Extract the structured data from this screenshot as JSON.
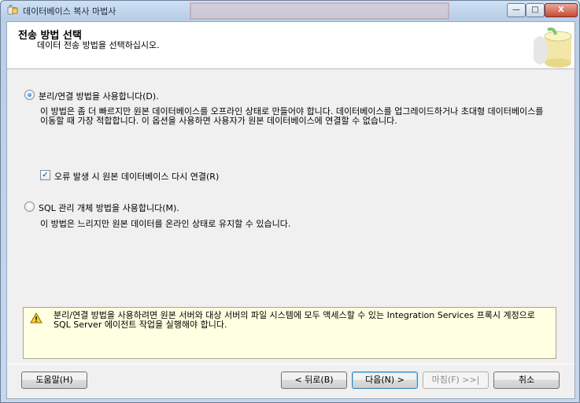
{
  "window": {
    "title": "데이터베이스 복사 마법사",
    "controls": {
      "minimize": "—",
      "maximize": "□",
      "close": "X"
    }
  },
  "header": {
    "title": "전송 방법 선택",
    "subtitle": "데이터 전송 방법을 선택하십시오."
  },
  "options": {
    "detach_attach": {
      "label": "분리/연결 방법을 사용합니다(D).",
      "selected": true,
      "description": "이 방법은 좀 더 빠르지만 원본 데이터베이스를 오프라인 상태로 만들어야 합니다. 데이터베이스를 업그레이드하거나 초대형 데이터베이스를 이동할 때 가장 적합합니다. 이 옵션을 사용하면 사용자가 원본 데이터베이스에 연결할 수 없습니다.",
      "reattach_checkbox": {
        "label": "오류 발생 시 원본 데이터베이스 다시 연결(R)",
        "checked": true
      }
    },
    "smo": {
      "label": "SQL 관리 개체 방법을 사용합니다(M).",
      "selected": false,
      "description": "이 방법은 느리지만 원본 데이터를 온라인 상태로 유지할 수 있습니다."
    }
  },
  "warning": {
    "text": "분리/연결 방법을 사용하려면 원본 서버와 대상 서버의 파일 시스템에 모두 액세스할 수 있는 Integration Services 프록시 계정으로 SQL Server 에이전트 작업을 실행해야 합니다."
  },
  "buttons": {
    "help": "도움말(H)",
    "back": "< 뒤로(B)",
    "next": "다음(N) >",
    "finish": "마침(F) >>|",
    "cancel": "취소"
  },
  "colors": {
    "warning_bg": "#ffffe1",
    "client_bg": "#f0f0f0",
    "titlebar_bg": "#c6d8ee"
  }
}
